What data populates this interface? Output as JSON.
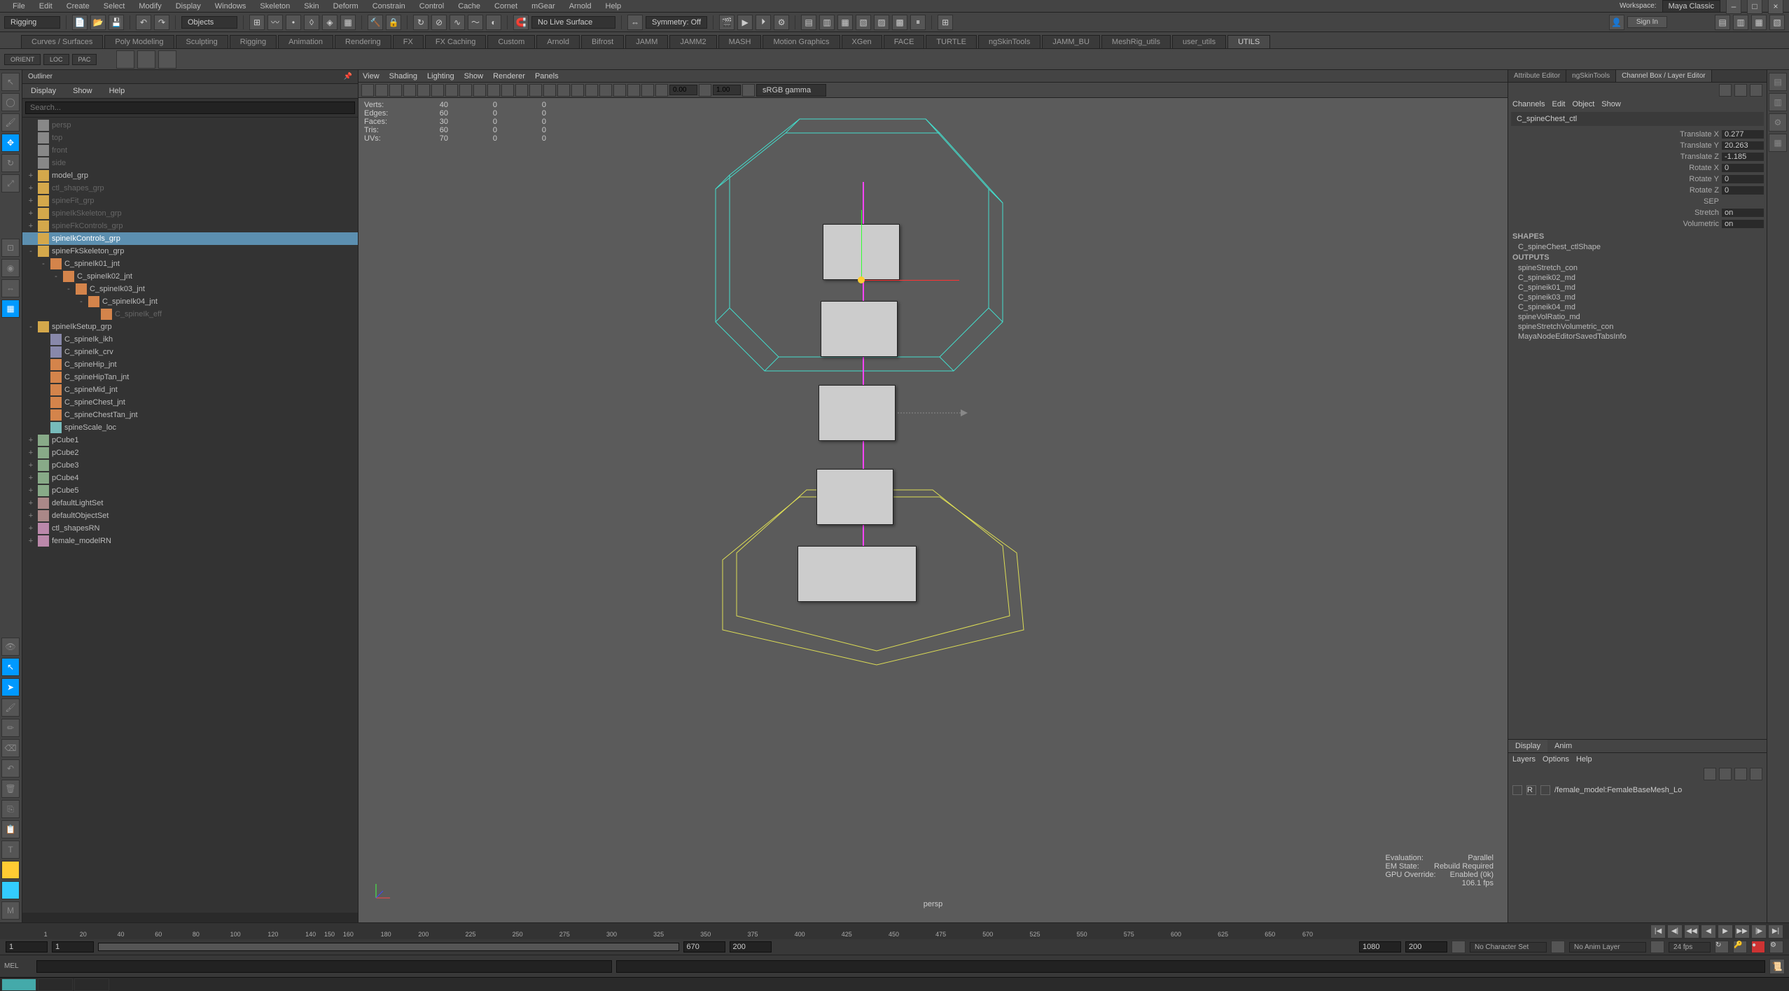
{
  "app": {
    "workspace_label": "Workspace:",
    "workspace_value": "Maya Classic"
  },
  "menubar": [
    "File",
    "Edit",
    "Create",
    "Select",
    "Modify",
    "Display",
    "Windows",
    "Skeleton",
    "Skin",
    "Deform",
    "Constrain",
    "Control",
    "Cache",
    "Cornet",
    "mGear",
    "Arnold",
    "Help"
  ],
  "toolbar": {
    "mode": "Rigging",
    "selection_type": "Objects",
    "surface": "No Live Surface",
    "symmetry": "Symmetry: Off",
    "signin": "Sign In"
  },
  "shelf_tabs": [
    "Curves / Surfaces",
    "Poly Modeling",
    "Sculpting",
    "Rigging",
    "Animation",
    "Rendering",
    "FX",
    "FX Caching",
    "Custom",
    "Arnold",
    "Bifrost",
    "JAMM",
    "JAMM2",
    "MASH",
    "Motion Graphics",
    "XGen",
    "FACE",
    "TURTLE",
    "ngSkinTools",
    "JAMM_BU",
    "MeshRig_utils",
    "user_utils",
    "UTILS"
  ],
  "shelf_left_buttons": [
    "ORIENT",
    "LOC",
    "PAC"
  ],
  "outliner": {
    "title": "Outliner",
    "menus": [
      "Display",
      "Show",
      "Help"
    ],
    "search_placeholder": "Search...",
    "items": [
      {
        "depth": 0,
        "kind": "camera",
        "label": "persp",
        "dim": true
      },
      {
        "depth": 0,
        "kind": "camera",
        "label": "top",
        "dim": true
      },
      {
        "depth": 0,
        "kind": "camera",
        "label": "front",
        "dim": true
      },
      {
        "depth": 0,
        "kind": "camera",
        "label": "side",
        "dim": true
      },
      {
        "depth": 0,
        "kind": "transform",
        "label": "model_grp",
        "exp": "+"
      },
      {
        "depth": 0,
        "kind": "transform",
        "label": "ctl_shapes_grp",
        "dim": true,
        "exp": "+"
      },
      {
        "depth": 0,
        "kind": "transform",
        "label": "spineFit_grp",
        "dim": true,
        "exp": "+"
      },
      {
        "depth": 0,
        "kind": "transform",
        "label": "spineIkSkeleton_grp",
        "dim": true,
        "exp": "+"
      },
      {
        "depth": 0,
        "kind": "transform",
        "label": "spineFkControls_grp",
        "dim": true,
        "exp": "+"
      },
      {
        "depth": 0,
        "kind": "transform",
        "label": "spineIkControls_grp",
        "selected": true,
        "exp": "-"
      },
      {
        "depth": 0,
        "kind": "transform",
        "label": "spineFkSkeleton_grp",
        "exp": "-"
      },
      {
        "depth": 1,
        "kind": "joint",
        "label": "C_spineIk01_jnt",
        "exp": "-"
      },
      {
        "depth": 2,
        "kind": "joint",
        "label": "C_spineIk02_jnt",
        "exp": "-"
      },
      {
        "depth": 3,
        "kind": "joint",
        "label": "C_spineIk03_jnt",
        "exp": "-"
      },
      {
        "depth": 4,
        "kind": "joint",
        "label": "C_spineIk04_jnt",
        "exp": "-"
      },
      {
        "depth": 5,
        "kind": "joint",
        "label": "C_spineIk_eff",
        "dim": true
      },
      {
        "depth": 0,
        "kind": "transform",
        "label": "spineIkSetup_grp",
        "exp": "-"
      },
      {
        "depth": 1,
        "kind": "curve",
        "label": "C_spineIk_ikh"
      },
      {
        "depth": 1,
        "kind": "curve",
        "label": "C_spineIk_crv"
      },
      {
        "depth": 1,
        "kind": "joint",
        "label": "C_spineHip_jnt"
      },
      {
        "depth": 1,
        "kind": "joint",
        "label": "C_spineHipTan_jnt"
      },
      {
        "depth": 1,
        "kind": "joint",
        "label": "C_spineMid_jnt"
      },
      {
        "depth": 1,
        "kind": "joint",
        "label": "C_spineChest_jnt"
      },
      {
        "depth": 1,
        "kind": "joint",
        "label": "C_spineChestTan_jnt"
      },
      {
        "depth": 1,
        "kind": "locator",
        "label": "spineScale_loc"
      },
      {
        "depth": 0,
        "kind": "mesh",
        "label": "pCube1",
        "exp": "+"
      },
      {
        "depth": 0,
        "kind": "mesh",
        "label": "pCube2",
        "exp": "+"
      },
      {
        "depth": 0,
        "kind": "mesh",
        "label": "pCube3",
        "exp": "+"
      },
      {
        "depth": 0,
        "kind": "mesh",
        "label": "pCube4",
        "exp": "+"
      },
      {
        "depth": 0,
        "kind": "mesh",
        "label": "pCube5",
        "exp": "+"
      },
      {
        "depth": 0,
        "kind": "set",
        "label": "defaultLightSet",
        "exp": "+"
      },
      {
        "depth": 0,
        "kind": "set",
        "label": "defaultObjectSet",
        "exp": "+"
      },
      {
        "depth": 0,
        "kind": "ref",
        "label": "ctl_shapesRN",
        "exp": "+"
      },
      {
        "depth": 0,
        "kind": "ref",
        "label": "female_modelRN",
        "exp": "+"
      }
    ]
  },
  "viewport": {
    "menus": [
      "View",
      "Shading",
      "Lighting",
      "Show",
      "Renderer",
      "Panels"
    ],
    "field1": "0.00",
    "field2": "1.00",
    "colorspace": "sRGB gamma",
    "camera": "persp",
    "hud_stats": [
      {
        "label": "Verts:",
        "a": "40",
        "b": "0",
        "c": "0"
      },
      {
        "label": "Edges:",
        "a": "60",
        "b": "0",
        "c": "0"
      },
      {
        "label": "Faces:",
        "a": "30",
        "b": "0",
        "c": "0"
      },
      {
        "label": "Tris:",
        "a": "60",
        "b": "0",
        "c": "0"
      },
      {
        "label": "UVs:",
        "a": "70",
        "b": "0",
        "c": "0"
      }
    ],
    "hud_eval": [
      {
        "label": "Evaluation:",
        "val": "Parallel"
      },
      {
        "label": "EM State:",
        "val": "Rebuild Required"
      },
      {
        "label": "GPU Override:",
        "val": "Enabled (0k)"
      },
      {
        "label": "",
        "val": "106.1 fps"
      }
    ]
  },
  "right_tabs": [
    "Attribute Editor",
    "ngSkinTools",
    "Channel Box / Layer Editor"
  ],
  "channelbox": {
    "menus": [
      "Channels",
      "Edit",
      "Object",
      "Show"
    ],
    "object": "C_spineChest_ctl",
    "channels": [
      {
        "label": "Translate X",
        "val": "0.277"
      },
      {
        "label": "Translate Y",
        "val": "20.263"
      },
      {
        "label": "Translate Z",
        "val": "-1.185"
      },
      {
        "label": "Rotate X",
        "val": "0"
      },
      {
        "label": "Rotate Y",
        "val": "0"
      },
      {
        "label": "Rotate Z",
        "val": "0"
      },
      {
        "label": "SEP",
        "val": ""
      },
      {
        "label": "Stretch",
        "val": "on"
      },
      {
        "label": "Volumetric",
        "val": "on"
      }
    ],
    "shapes_header": "SHAPES",
    "shapes": [
      "C_spineChest_ctlShape"
    ],
    "outputs_header": "OUTPUTS",
    "outputs": [
      "spineStretch_con",
      "C_spineik02_md",
      "C_spineik01_md",
      "C_spineik03_md",
      "C_spineik04_md",
      "spineVolRatio_md",
      "spineStretchVolumetric_con",
      "MayaNodeEditorSavedTabsInfo"
    ]
  },
  "layer_editor": {
    "tabs": [
      "Display",
      "Anim"
    ],
    "menus": [
      "Layers",
      "Options",
      "Help"
    ],
    "layers": [
      {
        "flag": "R",
        "name": "/female_model:FemaleBaseMesh_Lo"
      }
    ]
  },
  "timeline": {
    "ticks": [
      1,
      20,
      40,
      60,
      80,
      100,
      120,
      140,
      150,
      160,
      180,
      200,
      225,
      250,
      275,
      300,
      325,
      350,
      375,
      400,
      425,
      450,
      475,
      500,
      525,
      550,
      575,
      600,
      625,
      650,
      670
    ],
    "start": "1",
    "start2": "1",
    "end": "670",
    "end2": "670",
    "range_end1": "670",
    "range_end2": "200"
  },
  "range": {
    "current_frame": "1080",
    "end_frame": "200",
    "charset": "No Character Set",
    "animlayer": "No Anim Layer",
    "fps": "24 fps"
  },
  "cmdline": {
    "prompt": "MEL"
  }
}
